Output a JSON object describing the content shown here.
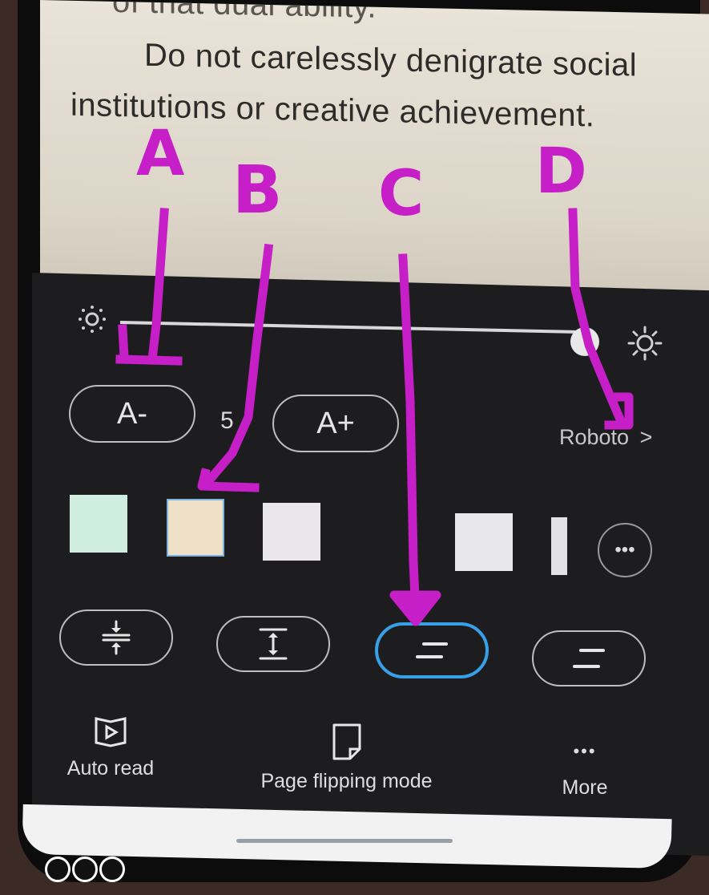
{
  "reader": {
    "line0": "of that dual ability.",
    "line1": "Do not carelessly denigrate social",
    "line2": "institutions or creative achievement."
  },
  "brightness": {
    "level": 0.94,
    "low_icon": "sun-dim-icon",
    "high_icon": "sun-bright-icon"
  },
  "font_controls": {
    "decrease_label": "A-",
    "size_value": "5",
    "increase_label": "A+",
    "font_name": "Roboto",
    "font_chevron": ">"
  },
  "themes": {
    "colors": [
      "#cfeee0",
      "#efe0c8",
      "#e9e7ea",
      "#e8e8ec",
      "#e2e2e6"
    ],
    "selected_index": 1,
    "more_label": "•••"
  },
  "spacing": {
    "options": [
      "compact-spacing-icon",
      "expand-spacing-icon",
      "medium-spacing-icon",
      "wide-spacing-icon"
    ],
    "selected_index": 2,
    "accent": "#38a0e6"
  },
  "bottom_menu": {
    "auto_read": "Auto read",
    "page_flip": "Page flipping mode",
    "more": "More",
    "more_icon": "•••"
  },
  "annotations": {
    "a": "A",
    "b": "B",
    "c": "C",
    "d": "D",
    "color": "#c71fc7"
  }
}
